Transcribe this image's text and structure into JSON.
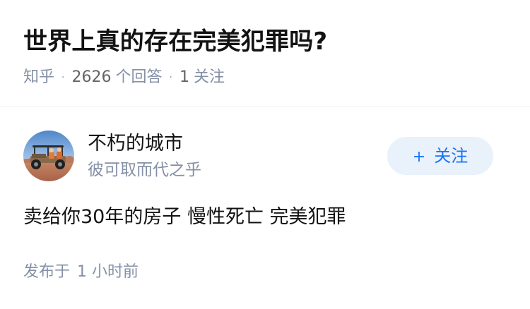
{
  "question": {
    "title": "世界上真的存在完美犯罪吗?",
    "source": "知乎",
    "separator": "·",
    "answer_count": "2626",
    "answer_count_label": "个回答",
    "follower_count": "1",
    "follower_label": "关注"
  },
  "answer": {
    "author": {
      "name": "不朽的城市",
      "headline": "彼可取而代之乎",
      "avatar_icon": "avatar-photo-buggy"
    },
    "follow_button": {
      "icon": "plus-icon",
      "plus": "+",
      "label": "关注",
      "color": "#1772f6",
      "background": "#e9f1fa"
    },
    "content": "卖给你30年的房子 慢性死亡 完美犯罪",
    "published_label": "发布于",
    "published_time": "1 小时前"
  }
}
